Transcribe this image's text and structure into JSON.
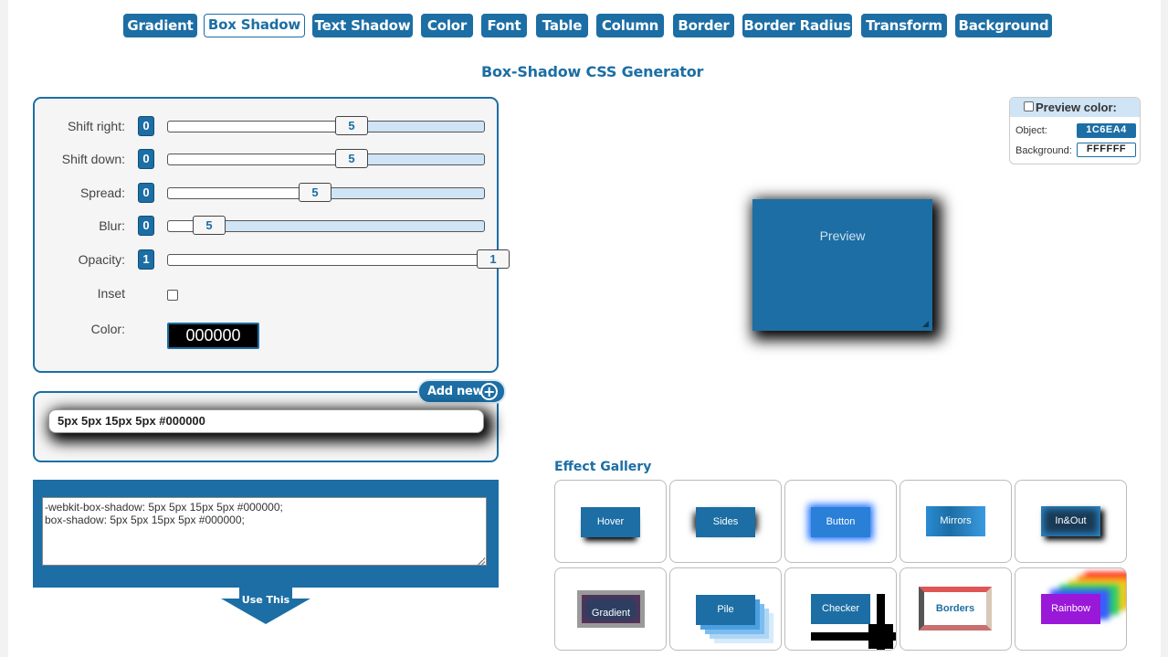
{
  "tabs": [
    {
      "label": "Gradient",
      "active": false
    },
    {
      "label": "Box Shadow",
      "active": true
    },
    {
      "label": "Text Shadow",
      "active": false
    },
    {
      "label": "Color",
      "active": false
    },
    {
      "label": "Font",
      "active": false
    },
    {
      "label": "Table",
      "active": false
    },
    {
      "label": "Column",
      "active": false
    },
    {
      "label": "Border",
      "active": false
    },
    {
      "label": "Border Radius",
      "active": false
    },
    {
      "label": "Transform",
      "active": false
    },
    {
      "label": "Background",
      "active": false
    }
  ],
  "title": "Box-Shadow CSS Generator",
  "controls": {
    "shift_right": {
      "label": "Shift right:",
      "badge": "0",
      "value": "5"
    },
    "shift_down": {
      "label": "Shift down:",
      "badge": "0",
      "value": "5"
    },
    "spread": {
      "label": "Spread:",
      "badge": "0",
      "value": "5"
    },
    "blur": {
      "label": "Blur:",
      "badge": "0",
      "value": "5"
    },
    "opacity": {
      "label": "Opacity:",
      "badge": "1",
      "value": "1"
    },
    "inset": {
      "label": "Inset",
      "checked": false
    },
    "color": {
      "label": "Color:",
      "value": "000000"
    }
  },
  "layers": {
    "add_new_label": "Add new",
    "items": [
      "5px 5px 15px 5px #000000"
    ]
  },
  "code": {
    "text": "-webkit-box-shadow: 5px 5px 15px 5px #000000;\nbox-shadow: 5px 5px 15px 5px #000000;",
    "use_this_label": "Use This"
  },
  "preview_color": {
    "header": "Preview color:",
    "object_label": "Object:",
    "object_value": "1C6EA4",
    "background_label": "Background:",
    "background_value": "FFFFFF"
  },
  "preview": {
    "label": "Preview"
  },
  "gallery": {
    "title": "Effect Gallery",
    "items": [
      "Hover",
      "Sides",
      "Button",
      "Mirrors",
      "In&Out",
      "Gradient",
      "Pile",
      "Checker",
      "Borders",
      "Rainbow"
    ]
  },
  "colors": {
    "accent": "#1c6ea4",
    "panel_bg": "#f5f5f5",
    "slider_track": "#cfe4f5"
  }
}
